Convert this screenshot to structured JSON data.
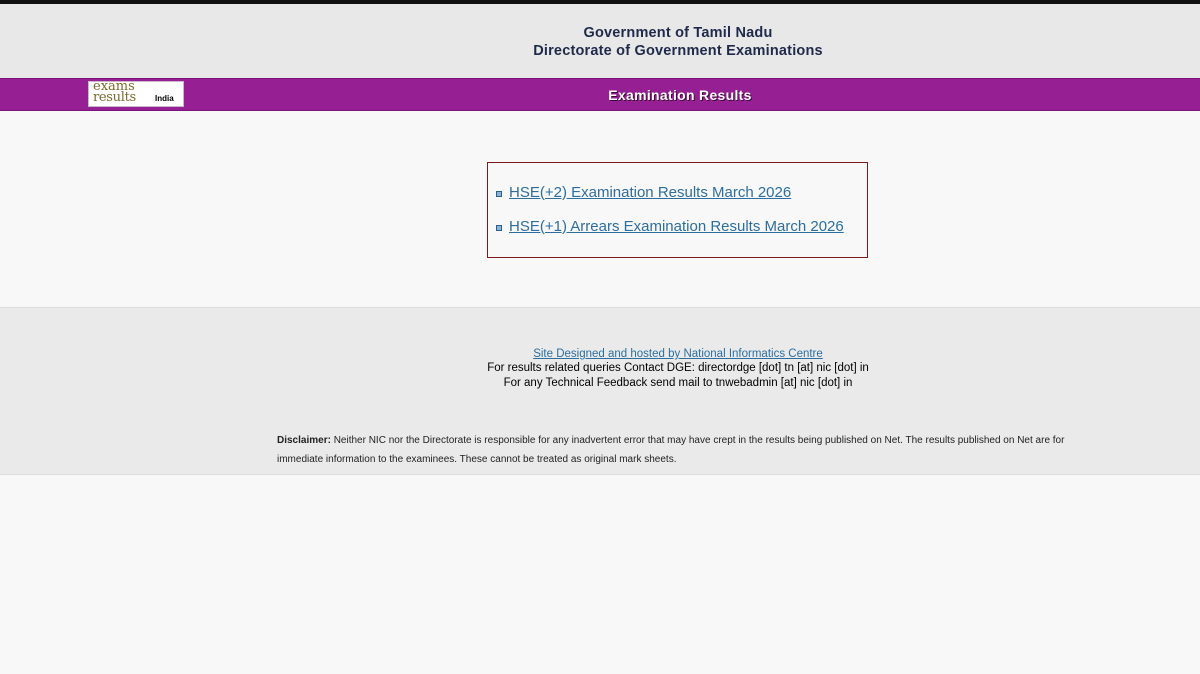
{
  "header": {
    "gov_title": "Government of Tamil Nadu",
    "dir_title": "Directorate of Government Examinations"
  },
  "logo": {
    "line1": "exams",
    "line2": "results",
    "suffix": "India"
  },
  "bar": {
    "title": "Examination Results"
  },
  "results": {
    "links": [
      {
        "label": "HSE(+2) Examination Results March 2026"
      },
      {
        "label": "HSE(+1) Arrears Examination Results March 2026"
      }
    ]
  },
  "footer": {
    "nic_link": "Site Designed and hosted by National Informatics Centre",
    "contact": "For results related queries Contact DGE:  directordge [dot] tn [at] nic [dot] in",
    "feedback": "For any Technical Feedback send mail to tnwebadmin [at] nic [dot] in",
    "disclaimer_label": "Disclaimer:",
    "disclaimer_text": " Neither NIC nor the Directorate is responsible for any inadvertent error that may have crept in the results being published on Net. The results published on Net are for immediate information to the examinees. These cannot be treated as original mark sheets."
  },
  "colors": {
    "purple_bar": "#962093",
    "link": "#2c6ea0",
    "box_border": "#7a1a1a",
    "header_text": "#1f2a4a"
  }
}
